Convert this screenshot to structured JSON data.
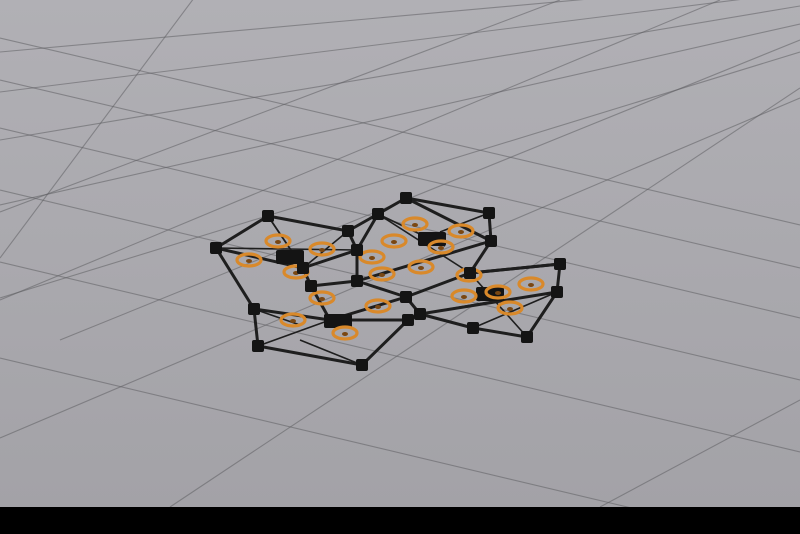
{
  "scene": {
    "view": "3d-simulation-viewport",
    "object": "modular-quadrotor-assembly",
    "module_count": 4,
    "propellers_per_module": 4
  },
  "colors": {
    "floor": "#a3a2a7",
    "floor_far": "#b1b0b5",
    "grid_line": "#5f5e63",
    "frame": "#1e1e1e",
    "joint": "#141414",
    "propeller": "#d9892a",
    "propeller_hub": "#7a4712",
    "letterbox": "#000000"
  }
}
